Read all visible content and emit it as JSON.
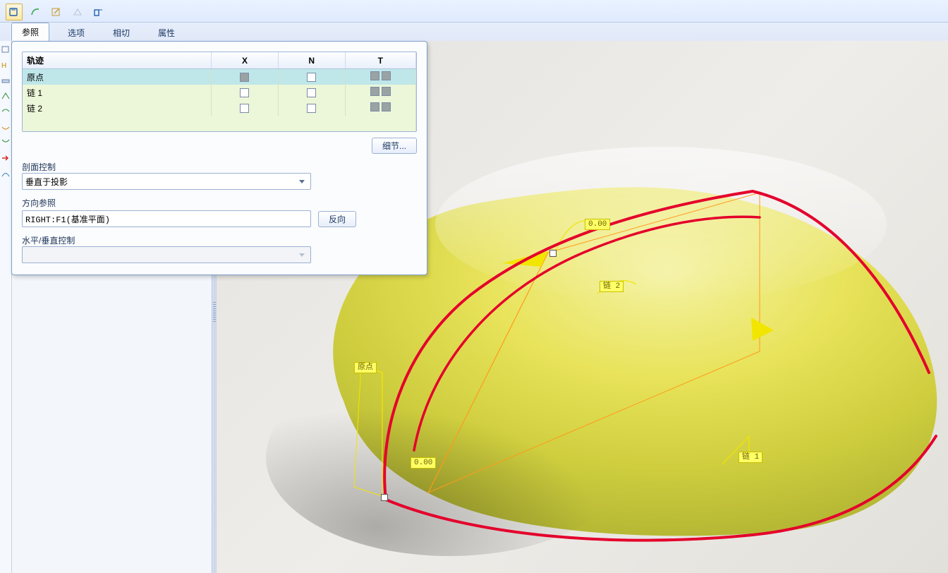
{
  "toolbar": {
    "active_index": 0
  },
  "tabs": {
    "items": [
      "参照",
      "选项",
      "相切",
      "属性"
    ],
    "active_index": 0
  },
  "reftable": {
    "headers": {
      "traj": "轨迹",
      "x": "X",
      "n": "N",
      "t": "T"
    },
    "rows": [
      {
        "name": "原点",
        "x": "filled",
        "n": "empty",
        "t": "dbl",
        "selected": true
      },
      {
        "name": "链 1",
        "x": "empty",
        "n": "empty",
        "t": "dbl",
        "selected": false
      },
      {
        "name": "链 2",
        "x": "empty",
        "n": "empty",
        "t": "dbl",
        "selected": false
      }
    ],
    "details_btn": "细节..."
  },
  "section_control": {
    "label": "剖面控制",
    "value": "垂直于投影"
  },
  "direction_ref": {
    "label": "方向参照",
    "value": "RIGHT:F1(基准平面)",
    "reverse_btn": "反向"
  },
  "hv_control": {
    "label": "水平/垂直控制",
    "value": ""
  },
  "viewport": {
    "labels": {
      "top": "0.00",
      "bottom": "0.00",
      "chain2": "链 2",
      "chain1": "链 1",
      "origin": "原点"
    }
  }
}
